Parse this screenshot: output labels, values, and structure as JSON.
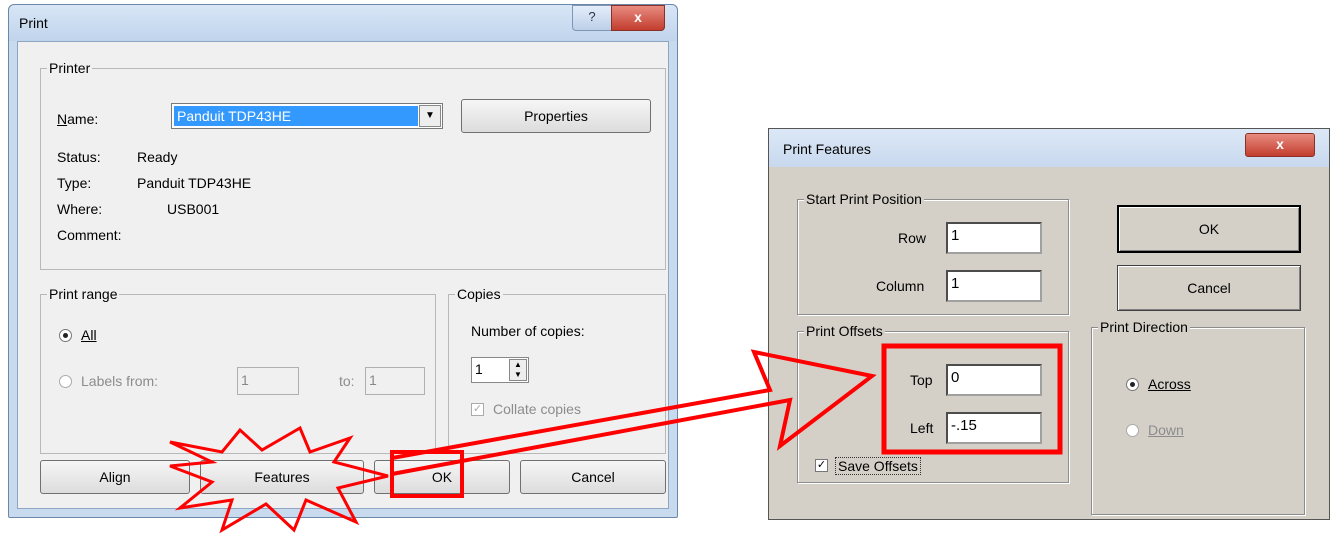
{
  "print_dialog": {
    "title": "Print",
    "help_glyph": "?",
    "close_glyph": "x",
    "printer_group": "Printer",
    "name_label": "Name:",
    "printer_name": "Panduit TDP43HE",
    "properties_button": "Properties",
    "status_label": "Status:",
    "status_value": "Ready",
    "type_label": "Type:",
    "type_value": "Panduit TDP43HE",
    "where_label": "Where:",
    "where_value": "USB001",
    "comment_label": "Comment:",
    "range_group": "Print range",
    "all_label": "All",
    "labels_from_label": "Labels from:",
    "labels_from_value": "1",
    "to_label": "to:",
    "to_value": "1",
    "copies_group": "Copies",
    "num_copies_label": "Number of copies:",
    "num_copies_value": "1",
    "collate_label": "Collate copies",
    "align_button": "Align",
    "features_button": "Features",
    "ok_button": "OK",
    "cancel_button": "Cancel"
  },
  "features_dialog": {
    "title": "Print Features",
    "close_glyph": "x",
    "start_group": "Start Print Position",
    "row_label": "Row",
    "row_value": "1",
    "column_label": "Column",
    "column_value": "1",
    "offsets_group": "Print Offsets",
    "top_label": "Top",
    "top_value": "0",
    "left_label": "Left",
    "left_value": "-.15",
    "save_offsets_label": "Save Offsets",
    "ok_button": "OK",
    "cancel_button": "Cancel",
    "direction_group": "Print Direction",
    "across_label": "Across",
    "down_label": "Down"
  },
  "colors": {
    "annotation_red": "#ff0000",
    "selection_blue": "#3399ff"
  }
}
